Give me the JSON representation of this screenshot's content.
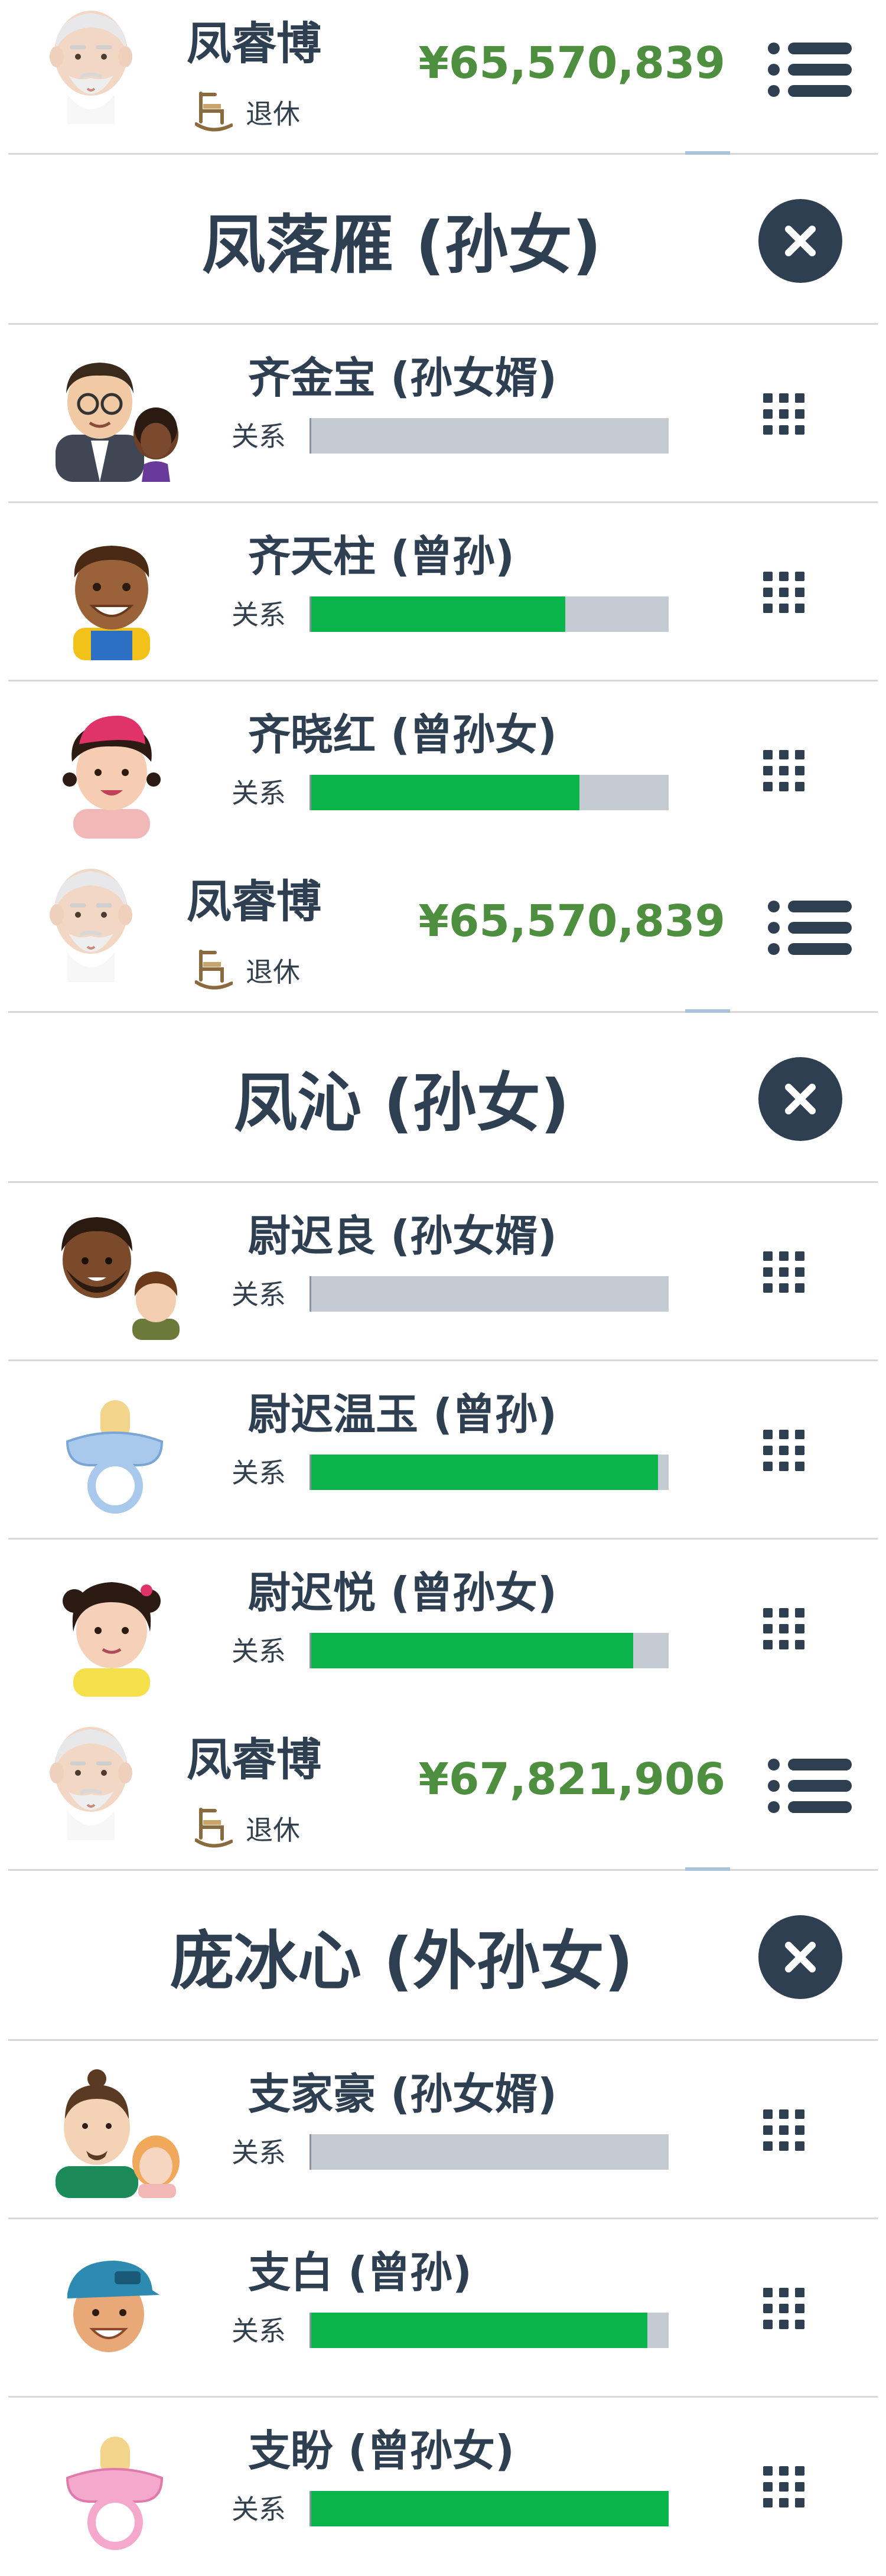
{
  "sections": [
    {
      "player": {
        "name": "凤睿博",
        "status": "退休",
        "money": "¥65,570,839"
      },
      "heir": {
        "title": "凤落雁 (孙女)"
      },
      "relatives": [
        {
          "name": "齐金宝 (孙女婿)",
          "label": "关系",
          "relationship": 0.0
        },
        {
          "name": "齐天柱 (曾孙)",
          "label": "关系",
          "relationship": 0.71
        },
        {
          "name": "齐晓红 (曾孙女)",
          "label": "关系",
          "relationship": 0.75
        }
      ]
    },
    {
      "player": {
        "name": "凤睿博",
        "status": "退休",
        "money": "¥65,570,839"
      },
      "heir": {
        "title": "凤沁 (孙女)"
      },
      "relatives": [
        {
          "name": "尉迟良 (孙女婿)",
          "label": "关系",
          "relationship": 0.0
        },
        {
          "name": "尉迟温玉 (曾孙)",
          "label": "关系",
          "relationship": 0.97
        },
        {
          "name": "尉迟悦 (曾孙女)",
          "label": "关系",
          "relationship": 0.9
        }
      ]
    },
    {
      "player": {
        "name": "凤睿博",
        "status": "退休",
        "money": "¥67,821,906"
      },
      "heir": {
        "title": "庞冰心 (外孙女)"
      },
      "relatives": [
        {
          "name": "支家豪 (孙女婿)",
          "label": "关系",
          "relationship": 0.0
        },
        {
          "name": "支白 (曾孙)",
          "label": "关系",
          "relationship": 0.94
        },
        {
          "name": "支盼 (曾孙女)",
          "label": "关系",
          "relationship": 1.0
        }
      ]
    }
  ],
  "colors": {
    "text_dark": "#2f3f52",
    "money_green": "#4d8f3f",
    "bar_fill": "#09b54b",
    "bar_track": "#c5cbd2",
    "divider": "#d8d8d8"
  },
  "icons": {
    "player_avatar": "old-man-avatar-icon",
    "status": "rocking-chair-icon",
    "menu": "list-menu-icon",
    "close": "close-icon",
    "relative_menu": "grid-menu-icon"
  }
}
